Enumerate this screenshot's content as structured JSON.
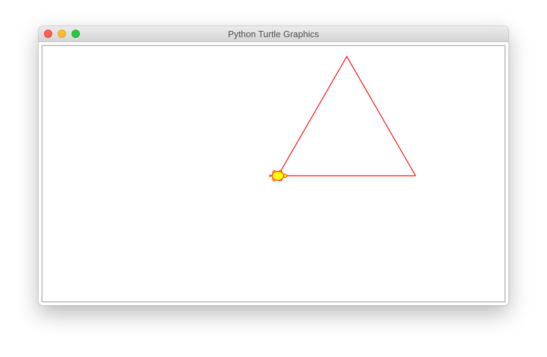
{
  "window": {
    "title": "Python Turtle Graphics"
  },
  "canvas": {
    "background": "#ffffff",
    "shape": "triangle",
    "side_length": 200,
    "pen_color": "#ff0000",
    "turtle_fill_color": "#ffff00",
    "turtle_outline_color": "#ff0000",
    "turtle_icon": "turtle-icon"
  }
}
